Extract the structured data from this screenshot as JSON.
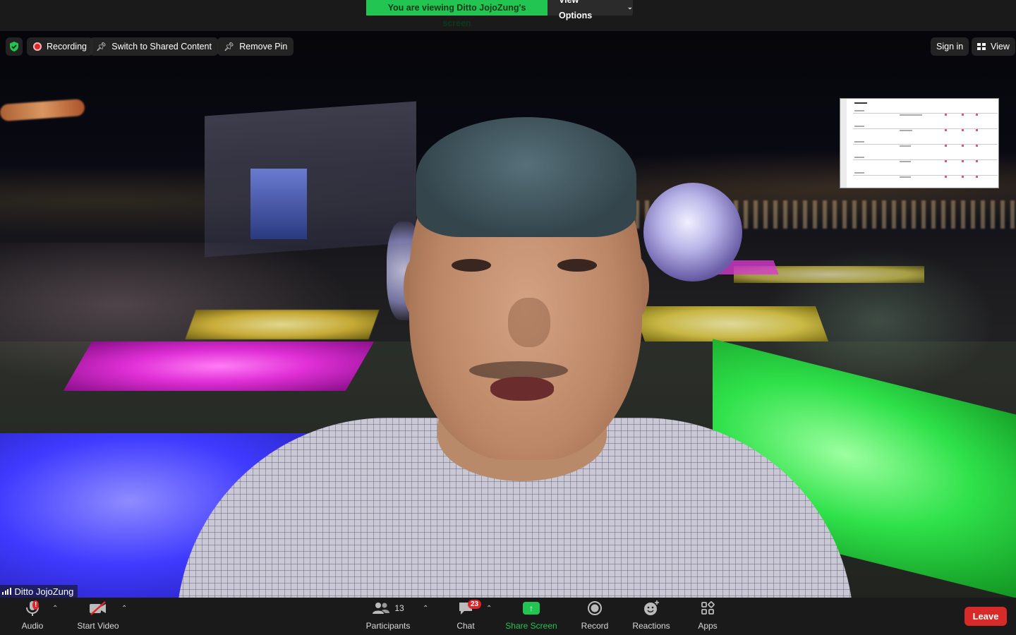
{
  "banner": {
    "viewing_text": "You are viewing Ditto JojoZung's screen",
    "view_options_label": "View Options"
  },
  "top_controls": {
    "recording_label": "Recording",
    "switch_label": "Switch to Shared Content",
    "remove_pin_label": "Remove Pin",
    "sign_in_label": "Sign in",
    "view_label": "View"
  },
  "video": {
    "participant_name": "Ditto JojoZung"
  },
  "toolbar": {
    "audio_label": "Audio",
    "audio_alert_badge": "!",
    "video_label": "Start Video",
    "participants_label": "Participants",
    "participants_count": "13",
    "chat_label": "Chat",
    "chat_badge": "23",
    "share_label": "Share Screen",
    "record_label": "Record",
    "reactions_label": "Reactions",
    "apps_label": "Apps",
    "leave_label": "Leave"
  },
  "colors": {
    "accent_green": "#23c552",
    "leave_red": "#d92a2a",
    "badge_red": "#e0242b",
    "toolbar_bg": "#1a1a1a"
  },
  "icons": [
    "shield-check-icon",
    "record-icon",
    "pin-icon",
    "grid-icon",
    "microphone-icon",
    "video-off-icon",
    "participants-icon",
    "chat-icon",
    "share-screen-icon",
    "record-button-icon",
    "reactions-icon",
    "apps-icon",
    "signal-bars-icon",
    "chevron-down-icon",
    "caret-up-icon"
  ]
}
